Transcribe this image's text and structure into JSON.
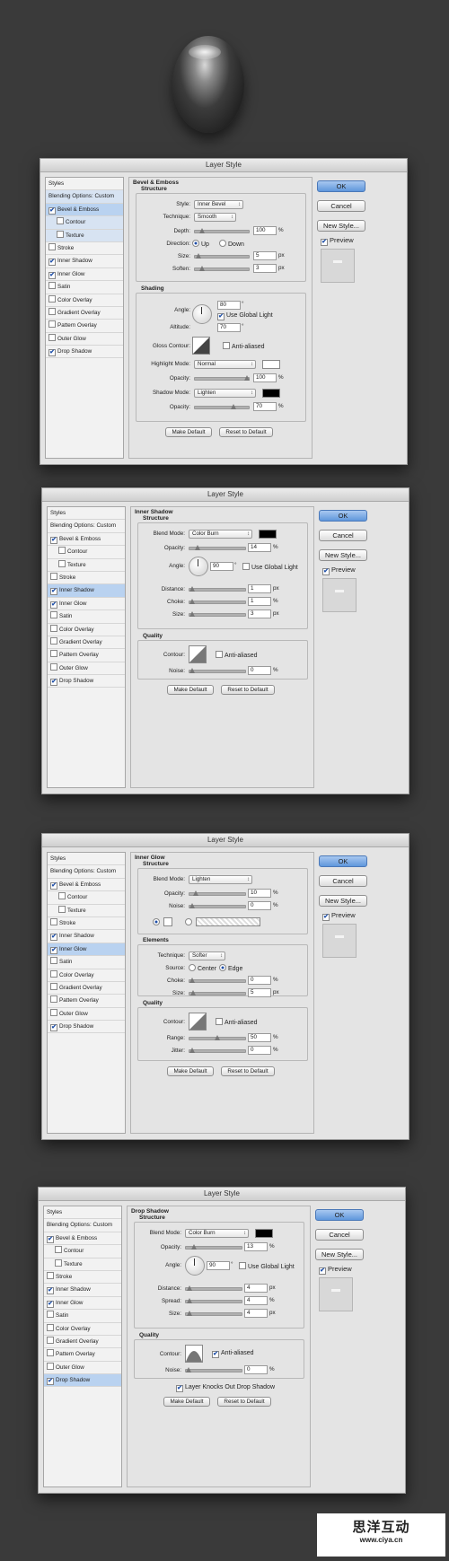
{
  "dialog_title": "Layer Style",
  "buttons": {
    "ok": "OK",
    "cancel": "Cancel",
    "new_style": "New Style...",
    "preview": "Preview",
    "make_default": "Make Default",
    "reset_default": "Reset to Default"
  },
  "sidebar": [
    "Styles",
    "Blending Options: Custom",
    "Bevel & Emboss",
    "Contour",
    "Texture",
    "Stroke",
    "Inner Shadow",
    "Inner Glow",
    "Satin",
    "Color Overlay",
    "Gradient Overlay",
    "Pattern Overlay",
    "Outer Glow",
    "Drop Shadow"
  ],
  "checked": {
    "bevel": true,
    "contour": false,
    "texture": false,
    "stroke": false,
    "inner_shadow": true,
    "inner_glow": true,
    "satin": false,
    "color_overlay": false,
    "gradient_overlay": false,
    "pattern_overlay": false,
    "outer_glow": false,
    "drop_shadow": true
  },
  "bevel": {
    "title": "Bevel & Emboss",
    "structure": "Structure",
    "style_label": "Style:",
    "style": "Inner Bevel",
    "technique_label": "Technique:",
    "technique": "Smooth",
    "depth_label": "Depth:",
    "depth": "100",
    "pct": "%",
    "direction_label": "Direction:",
    "up": "Up",
    "down": "Down",
    "size_label": "Size:",
    "size": "5",
    "px": "px",
    "soften_label": "Soften:",
    "soften": "3",
    "shading": "Shading",
    "angle_label": "Angle:",
    "angle": "80",
    "deg": "°",
    "global_light": "Use Global Light",
    "altitude_label": "Altitude:",
    "altitude": "70",
    "gloss_label": "Gloss Contour:",
    "anti_aliased": "Anti-aliased",
    "highlight_label": "Highlight Mode:",
    "highlight": "Normal",
    "hl_opacity": "100",
    "opacity_label": "Opacity:",
    "shadow_mode_label": "Shadow Mode:",
    "shadow_mode": "Lighten",
    "sh_opacity": "70",
    "highlight_color": "#ffffff",
    "shadow_color": "#000000"
  },
  "inner_shadow": {
    "title": "Inner Shadow",
    "structure": "Structure",
    "blend_label": "Blend Mode:",
    "blend": "Color Burn",
    "color": "#000000",
    "opacity_label": "Opacity:",
    "opacity": "14",
    "pct": "%",
    "angle_label": "Angle:",
    "angle": "90",
    "deg": "°",
    "global_light": "Use Global Light",
    "distance_label": "Distance:",
    "distance": "1",
    "px": "px",
    "choke_label": "Choke:",
    "choke": "1",
    "size_label": "Size:",
    "size": "3",
    "quality": "Quality",
    "contour_label": "Contour:",
    "anti_aliased": "Anti-aliased",
    "noise_label": "Noise:",
    "noise": "0"
  },
  "inner_glow": {
    "title": "Inner Glow",
    "structure": "Structure",
    "blend_label": "Blend Mode:",
    "blend": "Lighten",
    "opacity_label": "Opacity:",
    "opacity": "10",
    "pct": "%",
    "noise_label": "Noise:",
    "noise": "0",
    "elements": "Elements",
    "technique_label": "Technique:",
    "technique": "Softer",
    "source_label": "Source:",
    "center": "Center",
    "edge": "Edge",
    "choke_label": "Choke:",
    "choke": "0",
    "size_label": "Size:",
    "size": "5",
    "px": "px",
    "quality": "Quality",
    "contour_label": "Contour:",
    "anti_aliased": "Anti-aliased",
    "range_label": "Range:",
    "range": "50",
    "jitter_label": "Jitter:",
    "jitter": "0"
  },
  "drop_shadow": {
    "title": "Drop Shadow",
    "structure": "Structure",
    "blend_label": "Blend Mode:",
    "blend": "Color Burn",
    "color": "#000000",
    "opacity_label": "Opacity:",
    "opacity": "13",
    "pct": "%",
    "angle_label": "Angle:",
    "angle": "90",
    "deg": "°",
    "global_light": "Use Global Light",
    "distance_label": "Distance:",
    "distance": "4",
    "px": "px",
    "spread_label": "Spread:",
    "spread": "4",
    "size_label": "Size:",
    "size": "4",
    "quality": "Quality",
    "contour_label": "Contour:",
    "anti_aliased": "Anti-aliased",
    "noise_label": "Noise:",
    "noise": "0",
    "knockout": "Layer Knocks Out Drop Shadow"
  },
  "watermark": {
    "line1": "思洋互动",
    "line2": "www.ciya.cn"
  }
}
